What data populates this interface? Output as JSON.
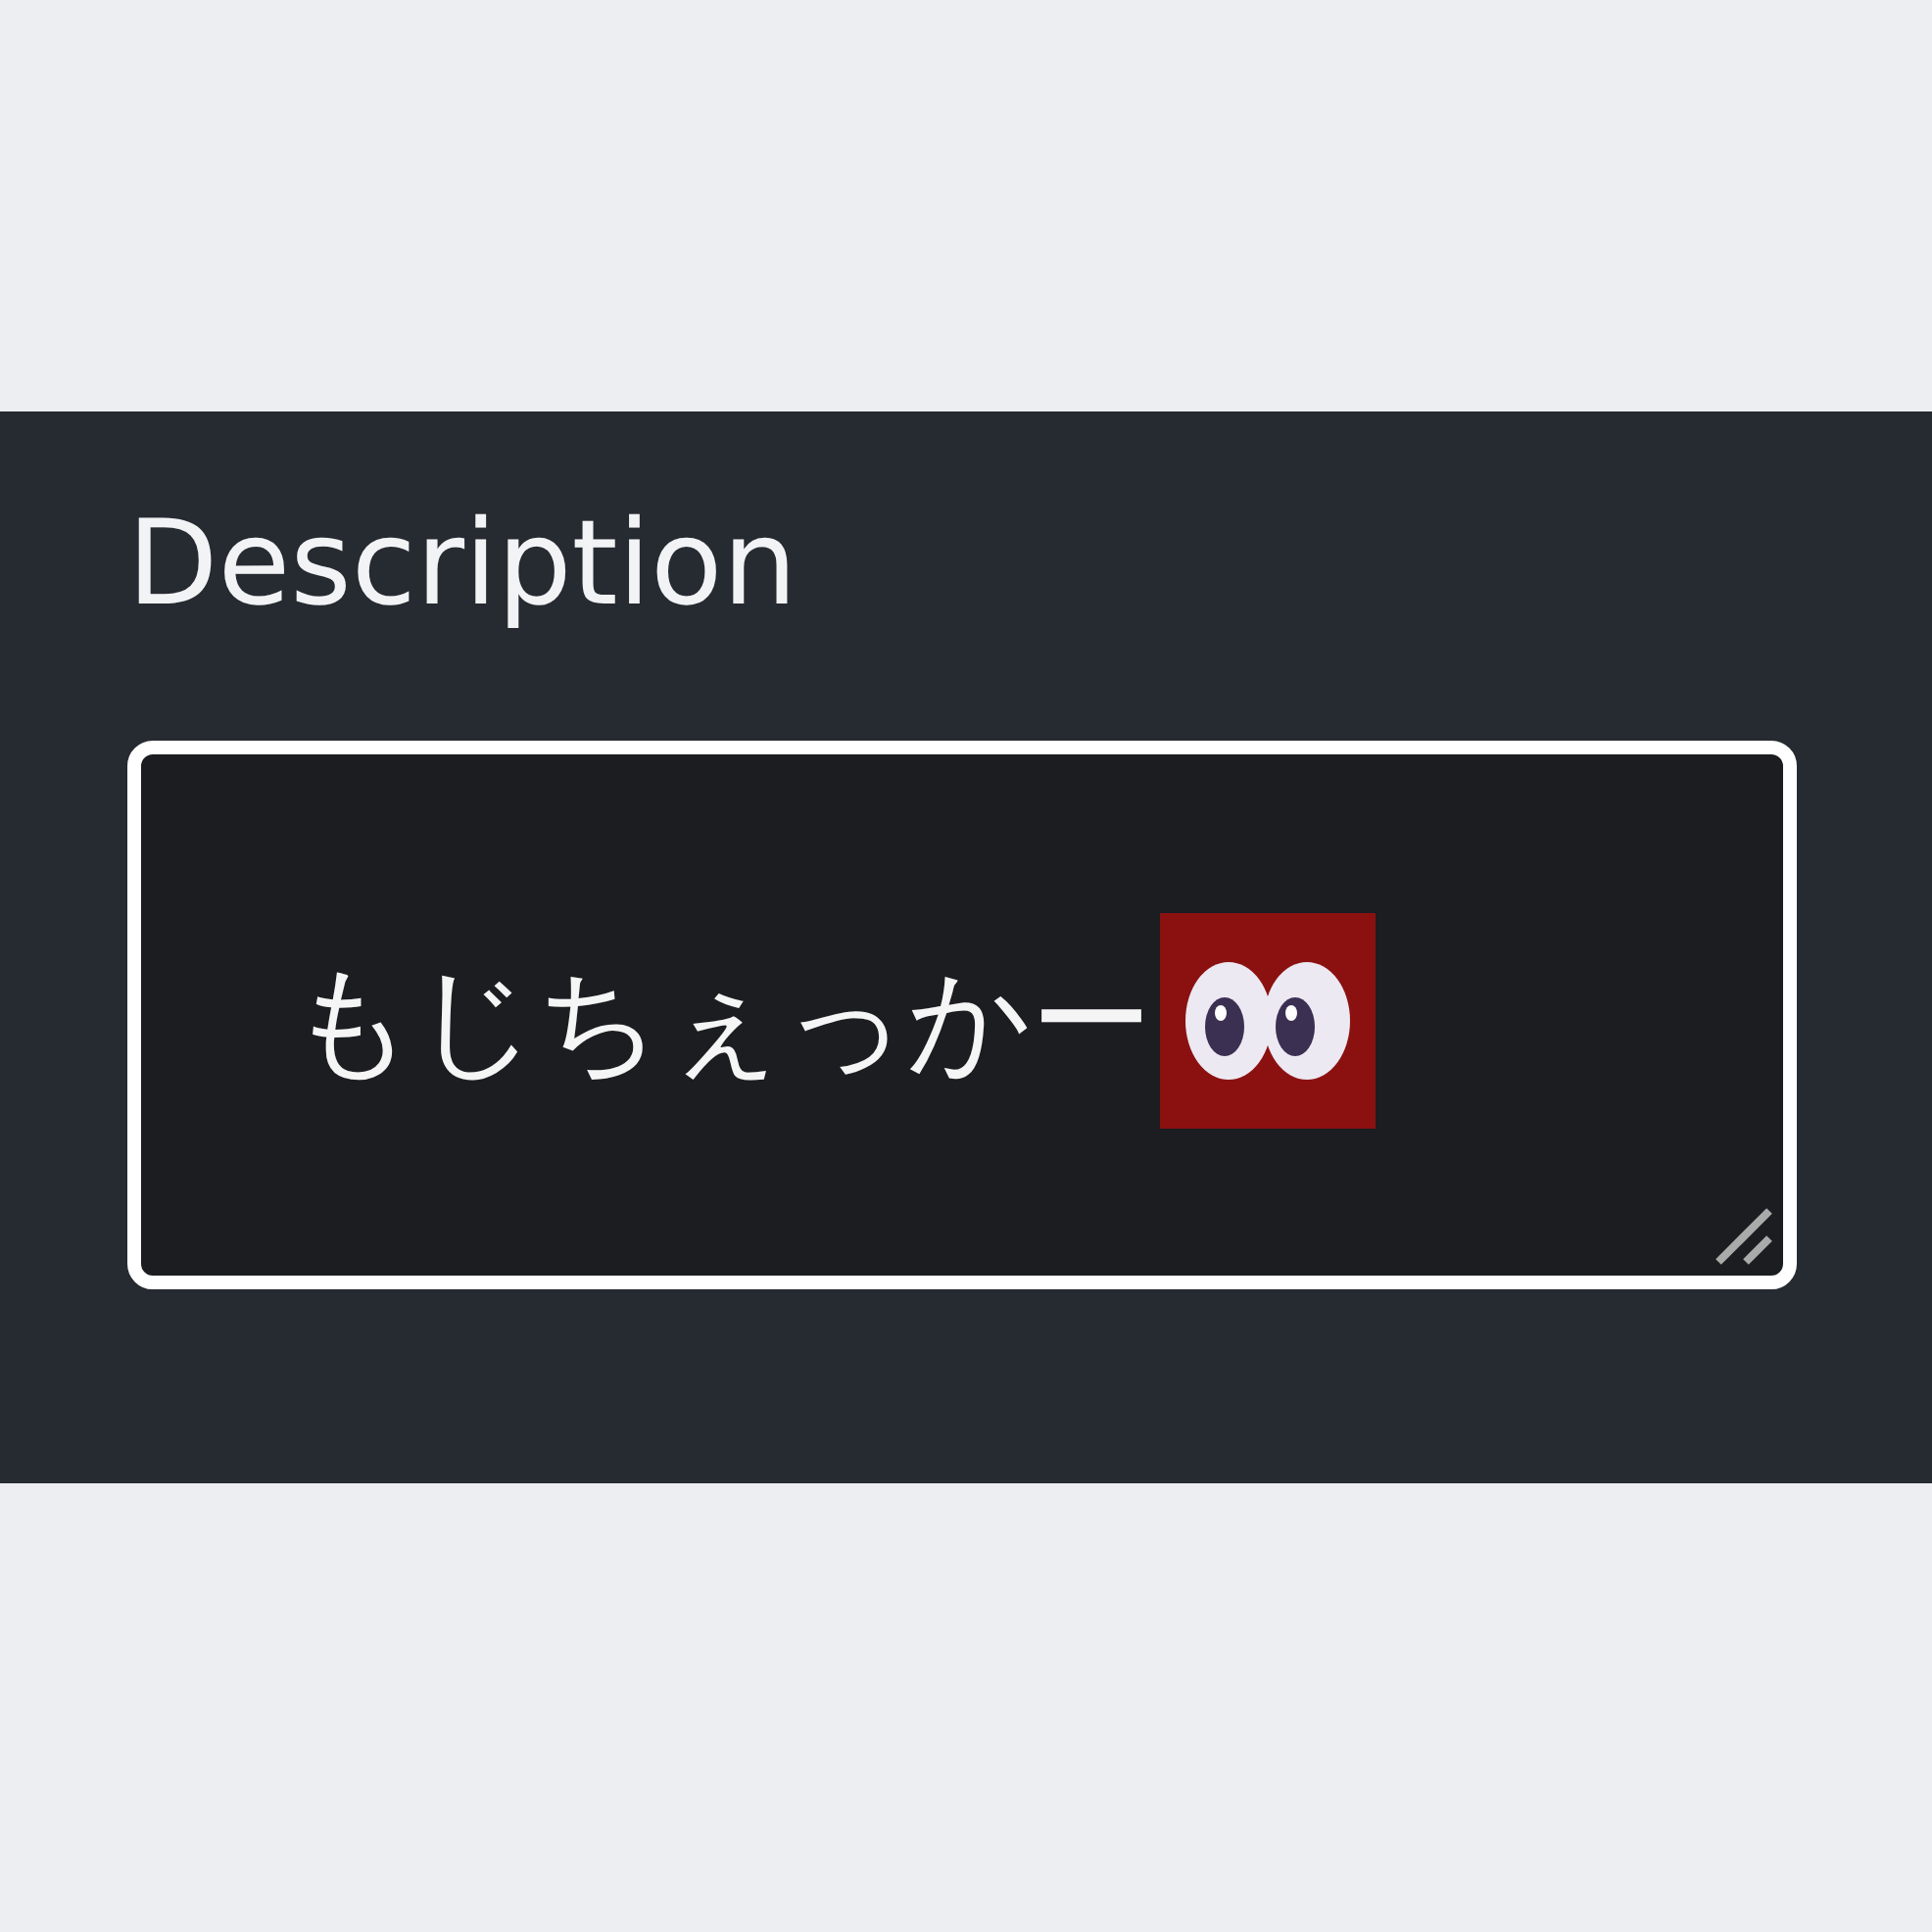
{
  "label": "Description",
  "field": {
    "value": "もじちぇっかー",
    "emoji_flagged": true,
    "resizable": true
  }
}
